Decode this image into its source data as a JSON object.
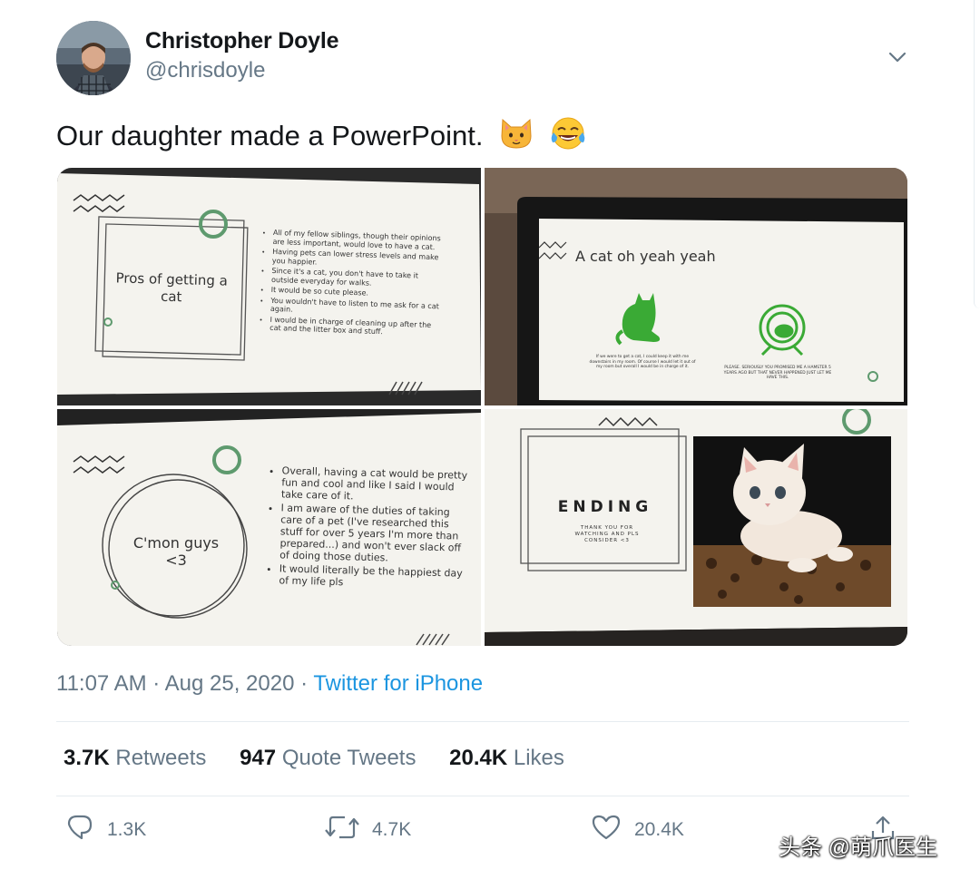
{
  "author": {
    "name": "Christopher Doyle",
    "handle": "@chrisdoyle",
    "avatar_icon": "profile-photo"
  },
  "tweet": {
    "text": "Our daughter made a PowerPoint.",
    "emojis": [
      "cat-face-emoji",
      "tears-of-joy-emoji"
    ]
  },
  "slides": [
    {
      "title": "Pros of getting a cat",
      "bullets": [
        "All of my fellow siblings, though their opinions are less important, would love to have a cat.",
        "Having pets can lower stress levels and make you happier.",
        "Since it's a cat, you don't have to take it outside everyday for walks.",
        "It would be so cute please.",
        "You wouldn't have to listen to me ask for a cat again.",
        "I would be in charge of cleaning up after the cat and the litter box and stuff."
      ]
    },
    {
      "title": "A cat oh yeah yeah",
      "left_caption": "If we were to get a cat, I could keep it with me downstairs in my room. Of course I would let it out of my room but overall I would be in charge of it.",
      "right_caption": "PLEASE. SERIOUSLY YOU PROMISED ME A HAMSTER 5 YEARS AGO BUT THAT NEVER HAPPENED JUST LET ME HAVE THIS.",
      "icons": [
        "cat-silhouette-icon",
        "hamster-wheel-icon"
      ]
    },
    {
      "title": "C'mon guys <3",
      "bullets": [
        "Overall, having a cat would be pretty fun and cool and like I said I would take care of it.",
        "I am aware of the duties of taking care of a pet (I've researched this stuff for over 5 years I'm more than prepared...) and won't ever slack off of doing those duties.",
        "It would literally be the happiest day of my life pls"
      ]
    },
    {
      "title": "ENDING",
      "subtitle": "THANK YOU FOR WATCHING AND PLS CONSIDER <3",
      "image": "kitten-photo"
    }
  ],
  "meta": {
    "time": "11:07 AM",
    "sep": "·",
    "date": "Aug 25, 2020",
    "source": "Twitter for iPhone"
  },
  "stats": [
    {
      "count": "3.7K",
      "label": "Retweets"
    },
    {
      "count": "947",
      "label": "Quote Tweets"
    },
    {
      "count": "20.4K",
      "label": "Likes"
    }
  ],
  "actions": {
    "reply_count": "1.3K",
    "retweet_count": "4.7K",
    "like_count": "20.4K"
  },
  "watermark": "头条 @萌爪医生",
  "colors": {
    "link": "#1b95e0",
    "muted": "#657786",
    "text": "#14171a",
    "slide_green": "#3aaa35",
    "divider": "#e6ecf0"
  }
}
